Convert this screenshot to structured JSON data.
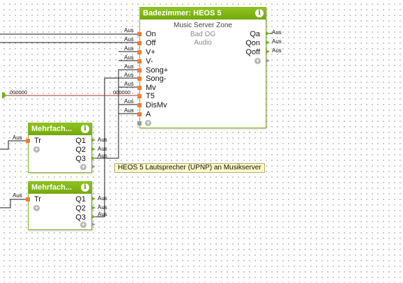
{
  "heos": {
    "title": "Badezimmer: HEOS 5",
    "subtitle": "Music Server Zone",
    "room": "Bad OG",
    "source": "Audio",
    "inputs": [
      "On",
      "Off",
      "V+",
      "V-",
      "Song+",
      "Song-",
      "Mv",
      "T5",
      "DisMv",
      "A"
    ],
    "input_wire_labels": [
      "Aus",
      "Aus",
      "Aus",
      "Aus",
      "Aus",
      "Aus",
      "Aus",
      "000000",
      "Aus",
      "Aus"
    ],
    "outputs": [
      "Qa",
      "Qon",
      "Qoff"
    ],
    "output_wire_labels": [
      "Aus",
      "Aus",
      "Aus"
    ],
    "info_icon": "i"
  },
  "mehrfach1": {
    "title": "Mehrfach...",
    "input": "Tr",
    "input_wire_label": "Aus",
    "outputs": [
      "Q1",
      "Q2",
      "Q3"
    ],
    "output_wire_labels": [
      "Aus",
      "Aus",
      "Aus"
    ],
    "info_icon": "i"
  },
  "mehrfach2": {
    "title": "Mehrfach...",
    "input": "Tr",
    "input_wire_label": "Aus",
    "outputs": [
      "Q1",
      "Q2",
      "Q3"
    ],
    "output_wire_labels": [
      "Aus",
      "Aus",
      "Aus"
    ],
    "info_icon": "i"
  },
  "left_wire_label": "000000",
  "comment": "HEOS 5 Lautsprecher (UPNP) an Musikserver",
  "plus_symbol": "+",
  "colors": {
    "block_green": "#86b817",
    "input_port": "#ef7d3b",
    "output_port": "#6fb31d",
    "wire_dark": "#1a1a1a",
    "wire_red": "#a03030",
    "comment_bg": "#fbf8c6"
  },
  "icons": [
    "info-icon",
    "add-connector-icon"
  ]
}
